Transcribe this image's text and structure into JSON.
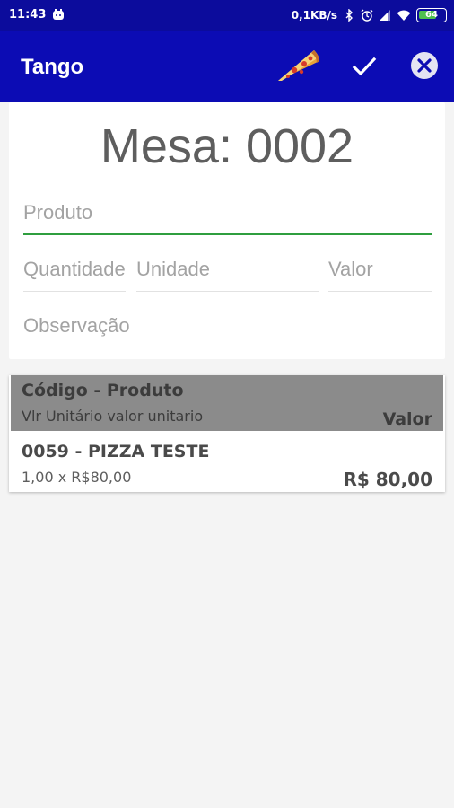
{
  "status_bar": {
    "time": "11:43",
    "network_speed": "0,1KB/s",
    "battery": "64"
  },
  "app_bar": {
    "title": "Tango",
    "icons": [
      "pizza-icon",
      "check-icon",
      "close-icon"
    ]
  },
  "form": {
    "mesa_label": "Mesa: 0002",
    "produto_placeholder": "Produto",
    "quantidade_placeholder": "Quantidade",
    "unidade_placeholder": "Unidade",
    "valor_placeholder": "Valor",
    "observacao_placeholder": "Observação"
  },
  "list": {
    "header": {
      "title": "Código - Produto",
      "subtitle": "Vlr Unitário  valor unitario",
      "valor": "Valor"
    },
    "items": [
      {
        "title": "0059 - PIZZA TESTE",
        "detail": "1,00  x  R$80,00",
        "total": "R$  80,00"
      }
    ]
  },
  "colors": {
    "app_bar": "#0c0cb4",
    "status_bar": "#0c0c9c",
    "focus_underline": "#2f9e3f",
    "list_header": "#8b8b8b"
  }
}
